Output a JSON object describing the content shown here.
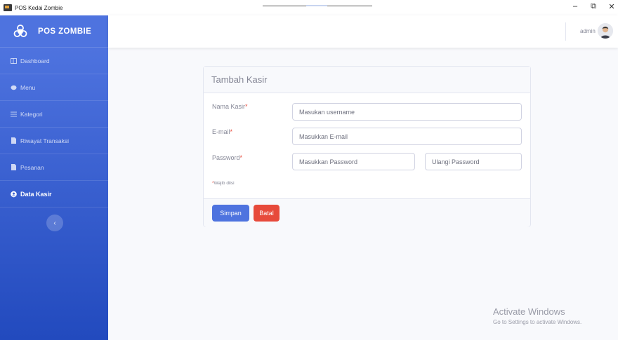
{
  "window": {
    "title": "POS Kedai Zombie",
    "controls": {
      "minimize": "–",
      "maximize": "⧉",
      "close": "✕"
    }
  },
  "sidebar": {
    "brand": "POS ZOMBIE",
    "items": [
      {
        "label": "Dashboard",
        "icon": "dashboard-icon"
      },
      {
        "label": "Menu",
        "icon": "menu-icon"
      },
      {
        "label": "Kategori",
        "icon": "list-icon"
      },
      {
        "label": "Riwayat Transaksi",
        "icon": "file-icon"
      },
      {
        "label": "Pesanan",
        "icon": "file-icon"
      },
      {
        "label": "Data Kasir",
        "icon": "user-circle-icon",
        "active": true
      }
    ],
    "toggle": "‹"
  },
  "topbar": {
    "user": "admin"
  },
  "form": {
    "title": "Tambah Kasir",
    "required_mark": "*",
    "name_label": "Nama Kasir",
    "name_placeholder": "Masukan username",
    "email_label": "E-mail",
    "email_placeholder": "Masukkan E-mail",
    "password_label": "Password",
    "password_placeholder": "Masukkan Password",
    "password_confirm_placeholder": "Ulangi Password",
    "required_note": "Wajib diisi",
    "save_label": "Simpan",
    "cancel_label": "Batal"
  },
  "watermark": {
    "title": "Activate Windows",
    "subtitle": "Go to Settings to activate Windows."
  },
  "colors": {
    "primary": "#4e73df",
    "danger": "#e74a3b",
    "sidebar_bottom": "#224abe"
  }
}
